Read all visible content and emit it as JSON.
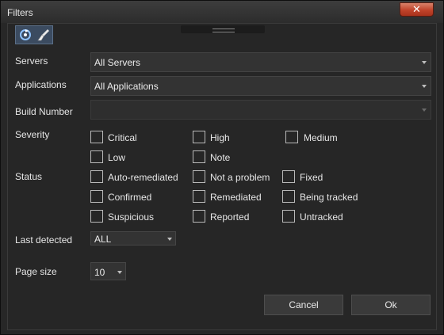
{
  "window": {
    "title": "Filters",
    "close_label": "✕"
  },
  "toolbar": {
    "refresh_icon": "refresh-icon",
    "clear_icon": "brush-icon"
  },
  "fields": {
    "servers": {
      "label": "Servers",
      "value": "All Servers"
    },
    "applications": {
      "label": "Applications",
      "value": "All Applications"
    },
    "build_number": {
      "label": "Build Number",
      "value": ""
    }
  },
  "severity": {
    "label": "Severity",
    "options": [
      {
        "label": "Critical",
        "checked": false
      },
      {
        "label": "High",
        "checked": false
      },
      {
        "label": "Medium",
        "checked": false
      },
      {
        "label": "Low",
        "checked": false
      },
      {
        "label": "Note",
        "checked": false
      }
    ]
  },
  "status": {
    "label": "Status",
    "options": [
      {
        "label": "Auto-remediated",
        "checked": false
      },
      {
        "label": "Not a problem",
        "checked": false
      },
      {
        "label": "Fixed",
        "checked": false
      },
      {
        "label": "Confirmed",
        "checked": false
      },
      {
        "label": "Remediated",
        "checked": false
      },
      {
        "label": "Being tracked",
        "checked": false
      },
      {
        "label": "Suspicious",
        "checked": false
      },
      {
        "label": "Reported",
        "checked": false
      },
      {
        "label": "Untracked",
        "checked": false
      }
    ]
  },
  "last_detected": {
    "label": "Last detected",
    "value": "ALL"
  },
  "page_size": {
    "label": "Page size",
    "value": "10"
  },
  "buttons": {
    "cancel": "Cancel",
    "ok": "Ok"
  },
  "colors": {
    "background": "#272727",
    "close_button": "#c0432a",
    "toolbar": "#3b4b60"
  }
}
